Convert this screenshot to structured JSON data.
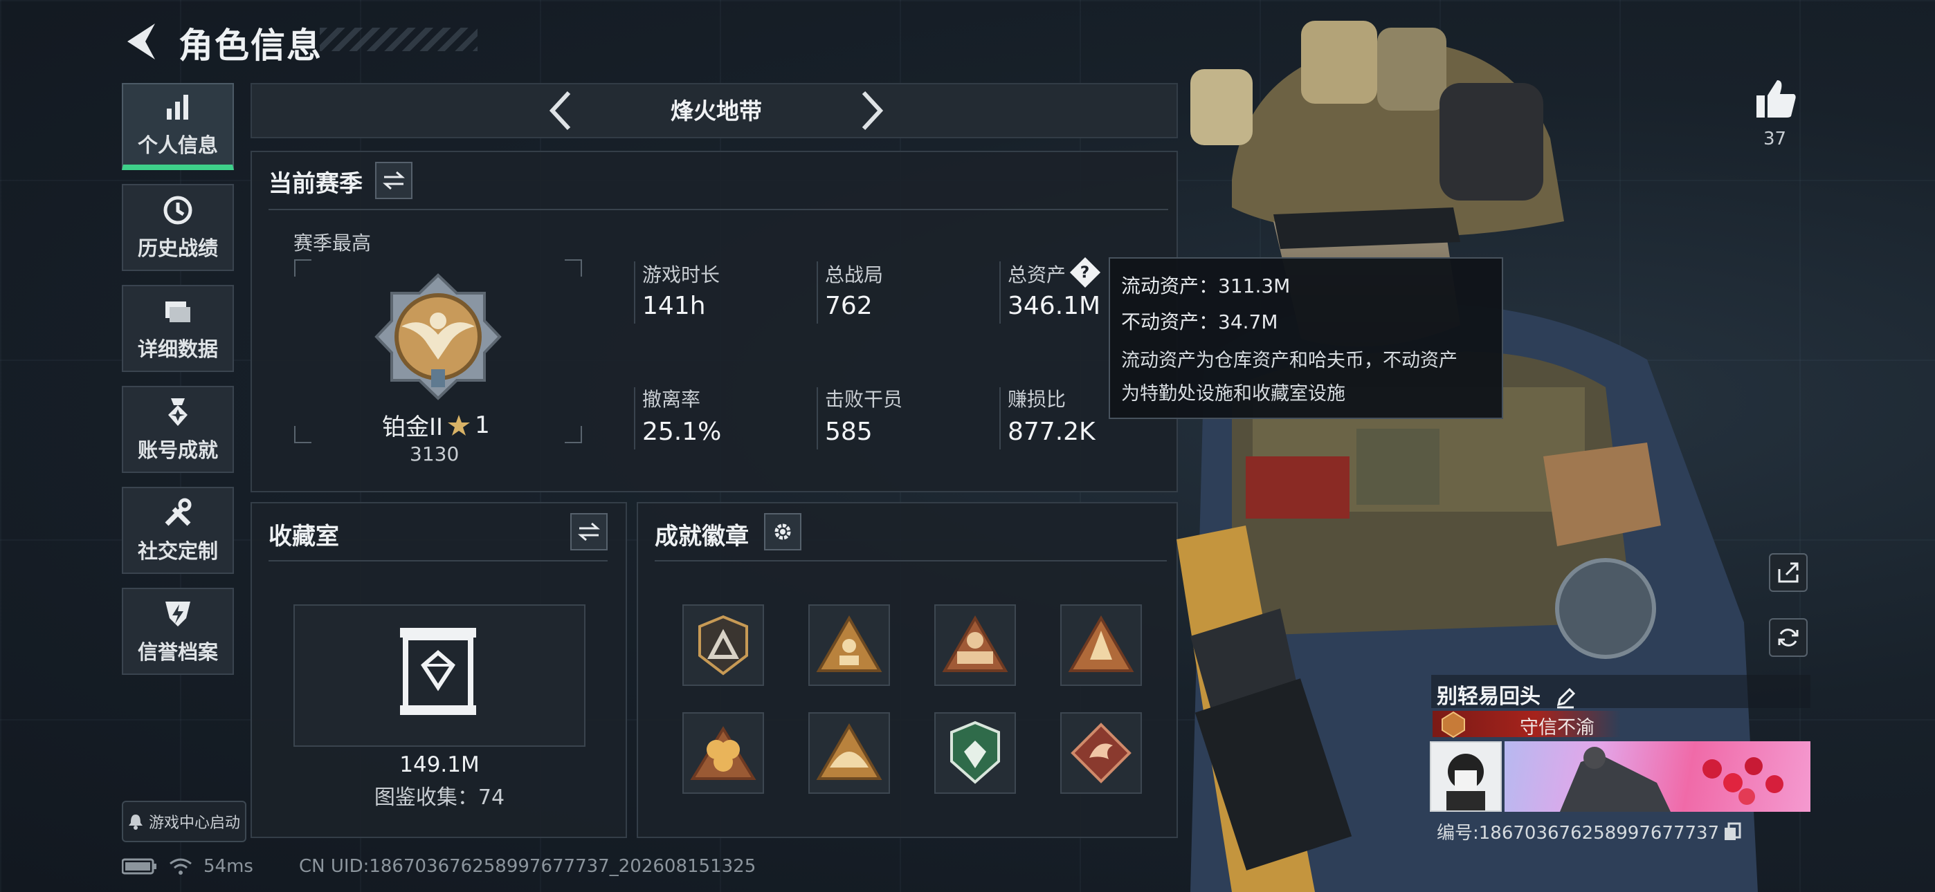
{
  "header": {
    "title": "角色信息"
  },
  "sidebar": {
    "items": [
      {
        "label": "个人信息",
        "icon": "bar-chart-icon",
        "active": true
      },
      {
        "label": "历史战绩",
        "icon": "history-icon",
        "active": false
      },
      {
        "label": "详细数据",
        "icon": "folder-icon",
        "active": false
      },
      {
        "label": "账号成就",
        "icon": "achievement-icon",
        "active": false
      },
      {
        "label": "社交定制",
        "icon": "tools-icon",
        "active": false
      },
      {
        "label": "信誉档案",
        "icon": "shield-icon",
        "active": false
      }
    ],
    "launch_button": "游戏中心启动"
  },
  "status_bar": {
    "ping": "54ms",
    "uid": "CN UID:1867036762589976777​37_202608151325"
  },
  "mode_selector": {
    "title": "烽火地带"
  },
  "season": {
    "title": "当前赛季",
    "best_label": "赛季最高",
    "rank_name": "铂金II",
    "rank_stars": "1",
    "rank_score": "3130",
    "stats": {
      "playtime_label": "游戏时长",
      "playtime_value": "141h",
      "matches_label": "总战局",
      "matches_value": "762",
      "assets_label": "总资产",
      "assets_value": "346.1M",
      "extract_label": "撤离率",
      "extract_value": "25.1%",
      "kills_label": "击败干员",
      "kills_value": "585",
      "ratio_label": "赚损比",
      "ratio_value": "877.2K"
    }
  },
  "tooltip": {
    "liquid": "流动资产：311.3M",
    "fixed": "不动资产：34.7M",
    "desc_line1": "流动资产为仓库资产和哈夫币，不动资产",
    "desc_line2": "为特勤处设施和收藏室设施"
  },
  "collection": {
    "title": "收藏室",
    "value": "149.1M",
    "count": "图鉴收集：74"
  },
  "badges": {
    "title": "成就徽章",
    "items": [
      "triangle-badge",
      "climber-badge",
      "squad-badge",
      "mountain-badge",
      "flower-badge",
      "hill-badge",
      "emerald-badge",
      "dragon-badge"
    ]
  },
  "social": {
    "likes": "37"
  },
  "profile": {
    "name": "别轻易回头",
    "title": "守信不渝",
    "id": "编号:186703676258997677737"
  },
  "colors": {
    "accent_green": "#3ed18a",
    "title_red": "#a6231c"
  }
}
